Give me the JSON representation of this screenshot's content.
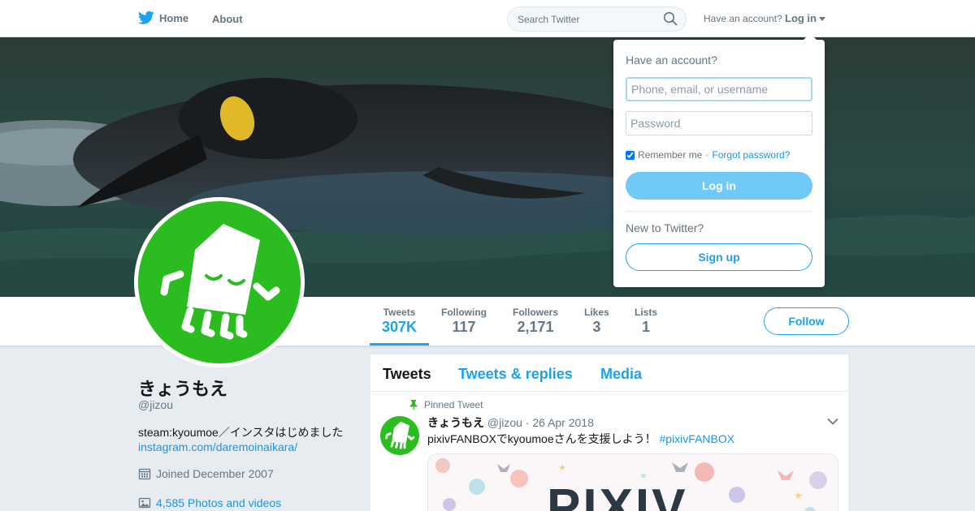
{
  "nav": {
    "home_label": "Home",
    "about_label": "About",
    "search_placeholder": "Search Twitter",
    "have_account_text": "Have an account?",
    "login_label": "Log in"
  },
  "colors": {
    "brand": "#1da1f2",
    "avatar_green": "#2bbd20",
    "login_button": "#71c9f8"
  },
  "login_dropdown": {
    "title": "Have an account?",
    "username_placeholder": "Phone, email, or username",
    "password_placeholder": "Password",
    "remember_label": "Remember me",
    "separator": "·",
    "forgot_label": "Forgot password?",
    "login_button": "Log in",
    "new_text": "New to Twitter?",
    "signup_button": "Sign up"
  },
  "stats": [
    {
      "label": "Tweets",
      "value": "307K",
      "active": true
    },
    {
      "label": "Following",
      "value": "117"
    },
    {
      "label": "Followers",
      "value": "2,171"
    },
    {
      "label": "Likes",
      "value": "3"
    },
    {
      "label": "Lists",
      "value": "1"
    }
  ],
  "follow_label": "Follow",
  "profile": {
    "name": "きょうもえ",
    "handle": "@jizou",
    "bio": "steam:kyoumoe／インスタはじめました",
    "link": "instagram.com/daremoinaikara/",
    "joined": "Joined December 2007",
    "photos": "4,585 Photos and videos"
  },
  "timeline": {
    "tabs": [
      "Tweets",
      "Tweets & replies",
      "Media"
    ],
    "pinned_label": "Pinned Tweet",
    "tweet": {
      "name": "きょうもえ",
      "handle": "@jizou",
      "separator": "·",
      "date": "26 Apr 2018",
      "text": "pixivFANBOXでkyoumoeさんを支援しよう！",
      "hashtag": "#pixivFANBOX",
      "card_title": "PIXIV"
    }
  },
  "icons": [
    "twitter-bird-icon",
    "search-icon",
    "caret-down-icon",
    "calendar-icon",
    "photo-icon",
    "pin-icon",
    "chevron-down-icon"
  ]
}
